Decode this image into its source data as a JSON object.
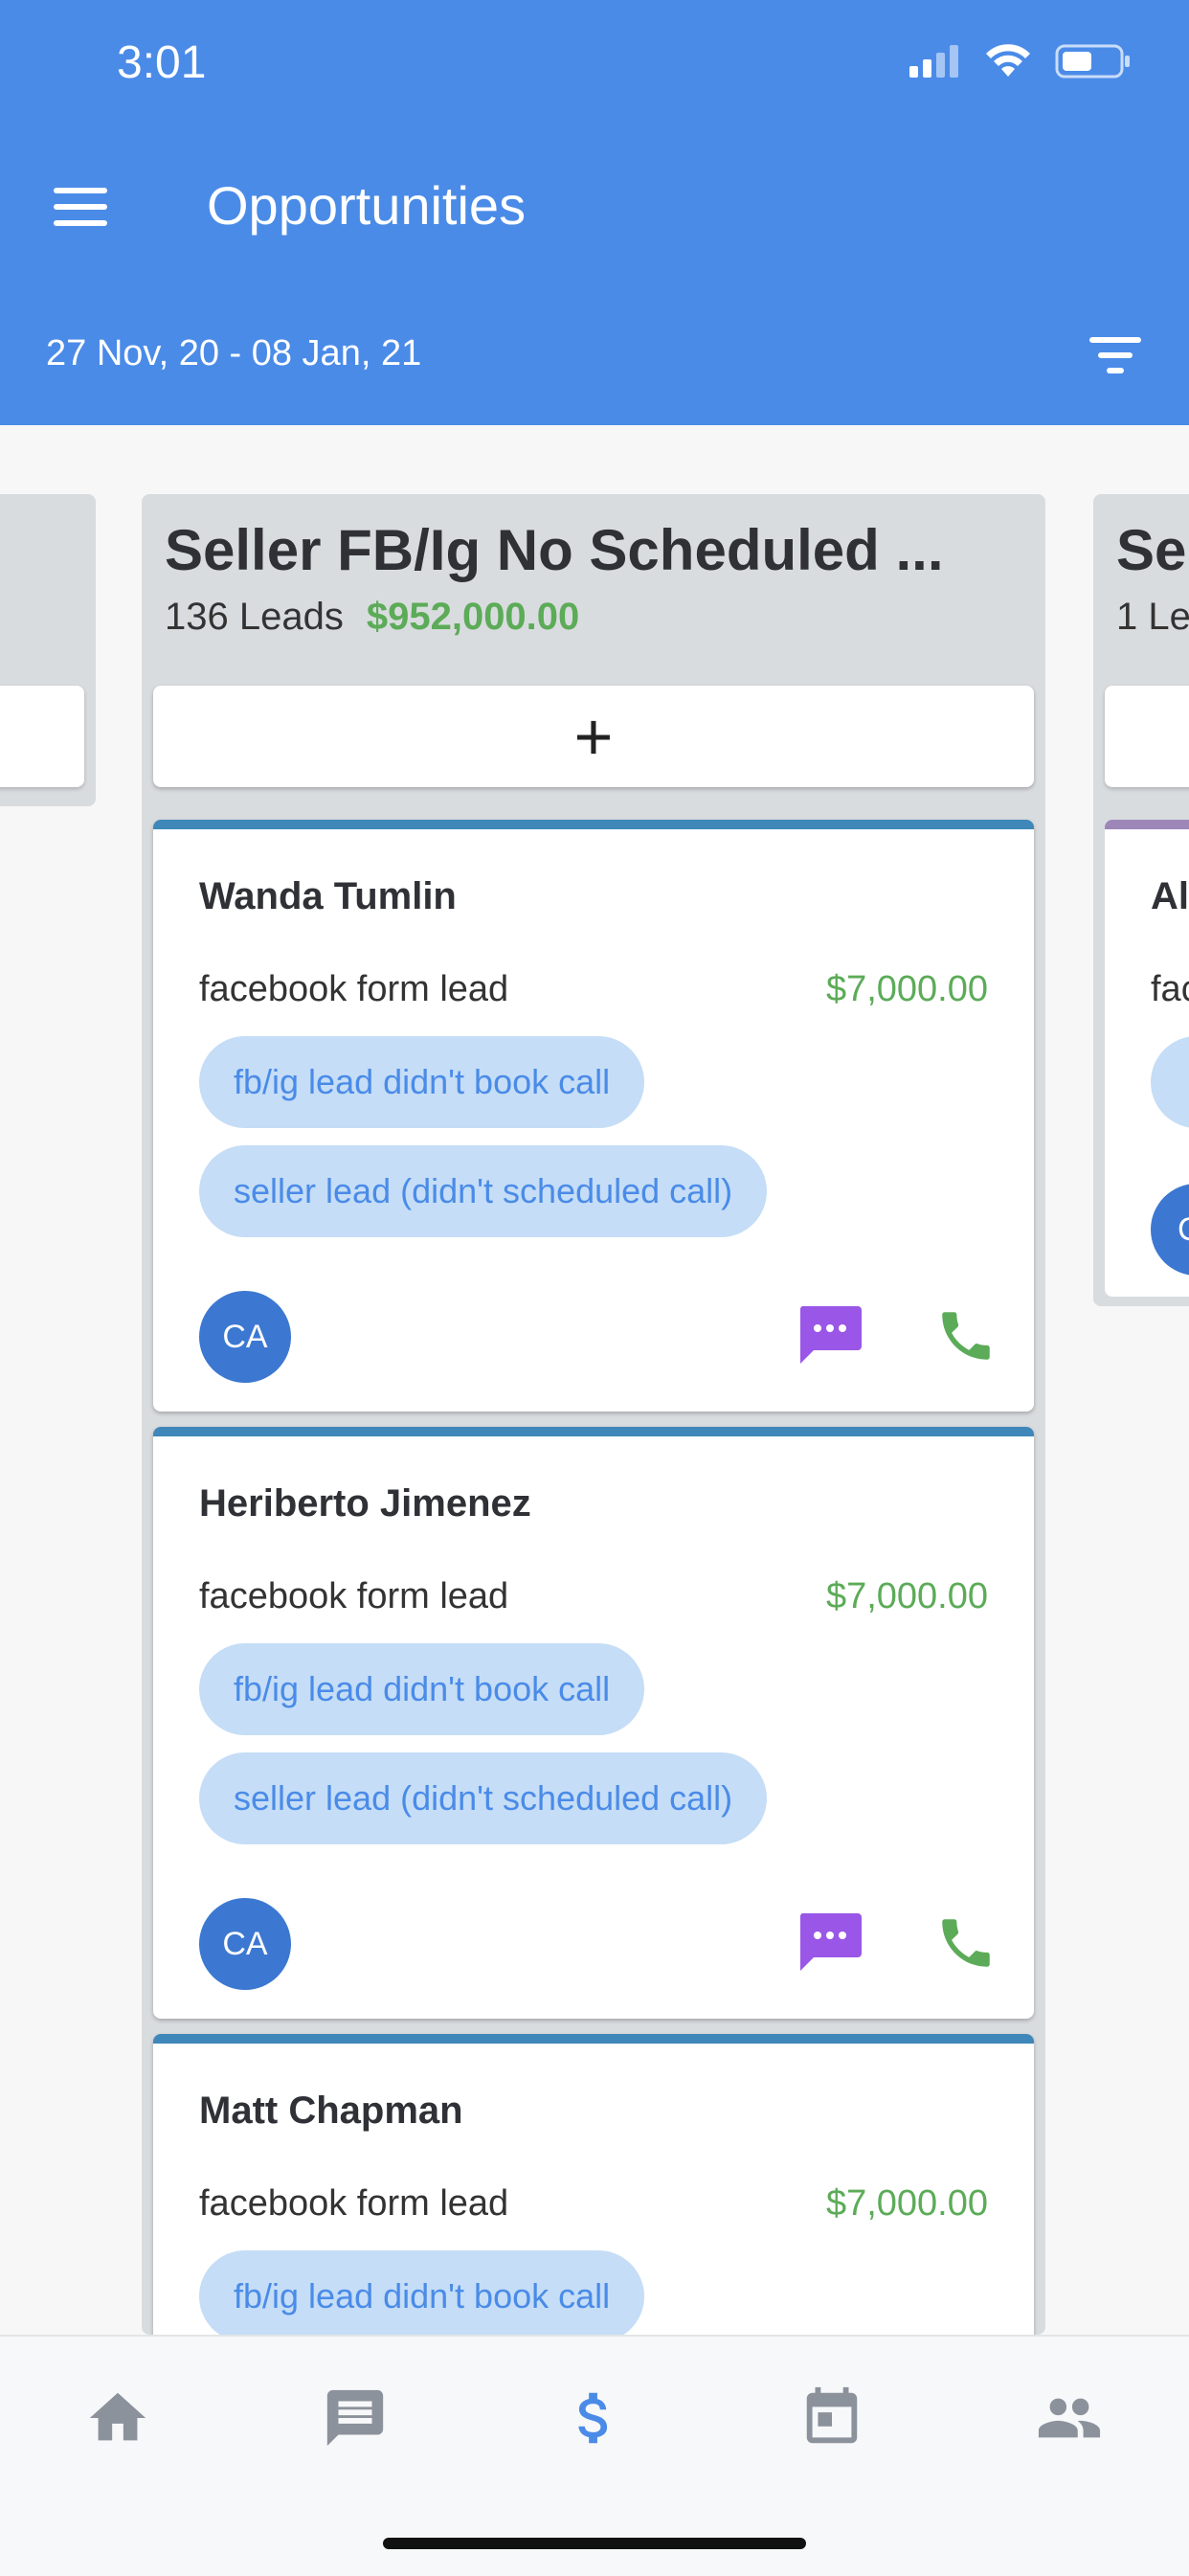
{
  "status_bar": {
    "time": "3:01"
  },
  "header": {
    "title": "Opportunities",
    "date_range": "27 Nov, 20 - 08 Jan, 21"
  },
  "board": {
    "main_column": {
      "title": "Seller FB/Ig No Scheduled ...",
      "lead_count": "136 Leads",
      "amount": "$952,000.00",
      "add_label": "+",
      "cards": [
        {
          "name": "Wanda Tumlin",
          "source": "facebook form lead",
          "value": "$7,000.00",
          "tags": [
            "fb/ig lead didn't book call",
            "seller lead (didn't scheduled call)"
          ],
          "avatar": "CA"
        },
        {
          "name": "Heriberto Jimenez",
          "source": "facebook form lead",
          "value": "$7,000.00",
          "tags": [
            "fb/ig lead didn't book call",
            "seller lead (didn't scheduled call)"
          ],
          "avatar": "CA"
        },
        {
          "name": "Matt Chapman",
          "source": "facebook form lead",
          "value": "$7,000.00",
          "tags": [
            "fb/ig lead didn't book call"
          ]
        }
      ]
    },
    "right_column": {
      "title": "Se",
      "lead_count": "1 Lea",
      "card": {
        "name": "Al",
        "source": "fac",
        "avatar": "C"
      }
    }
  },
  "tabbar": {
    "tabs": [
      {
        "name": "home-icon",
        "active": false
      },
      {
        "name": "conversations-icon",
        "active": false
      },
      {
        "name": "opportunities-dollar-icon",
        "active": true
      },
      {
        "name": "calendar-icon",
        "active": false
      },
      {
        "name": "contacts-icon",
        "active": false
      }
    ]
  },
  "colors": {
    "header_bg": "#4a8be8",
    "amount_green": "#5cab58",
    "tag_bg": "#c5ddf6",
    "tag_text": "#4a8be8",
    "avatar_bg": "#3c78d1",
    "message_purple": "#9a56e6",
    "call_green": "#5cab58",
    "tab_inactive": "#8c929b"
  }
}
